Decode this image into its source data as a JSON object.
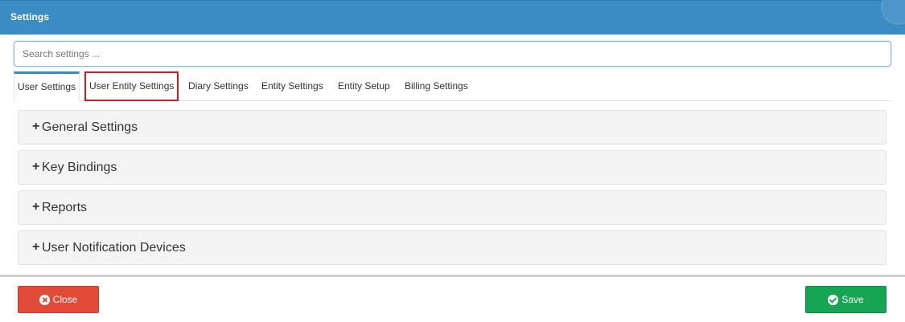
{
  "window": {
    "title": "Settings"
  },
  "search": {
    "placeholder": "Search settings ...",
    "value": ""
  },
  "tabs": [
    {
      "label": "User Settings",
      "active": true
    },
    {
      "label": "User Entity Settings",
      "highlighted": true
    },
    {
      "label": "Diary Settings"
    },
    {
      "label": "Entity Settings"
    },
    {
      "label": "Entity Setup"
    },
    {
      "label": "Billing Settings"
    }
  ],
  "sections": [
    {
      "expand_symbol": "+",
      "label": "General Settings"
    },
    {
      "expand_symbol": "+",
      "label": "Key Bindings"
    },
    {
      "expand_symbol": "+",
      "label": "Reports"
    },
    {
      "expand_symbol": "+",
      "label": "User Notification Devices"
    }
  ],
  "footer": {
    "close_label": "Close",
    "save_label": "Save"
  },
  "colors": {
    "titlebar": "#3b8bc4",
    "close_button": "#e14b37",
    "save_button": "#15a553",
    "highlight_outline": "#d01c24"
  },
  "icons": {
    "close": "close-circle-icon",
    "save": "check-circle-icon",
    "expand": "plus-icon"
  }
}
